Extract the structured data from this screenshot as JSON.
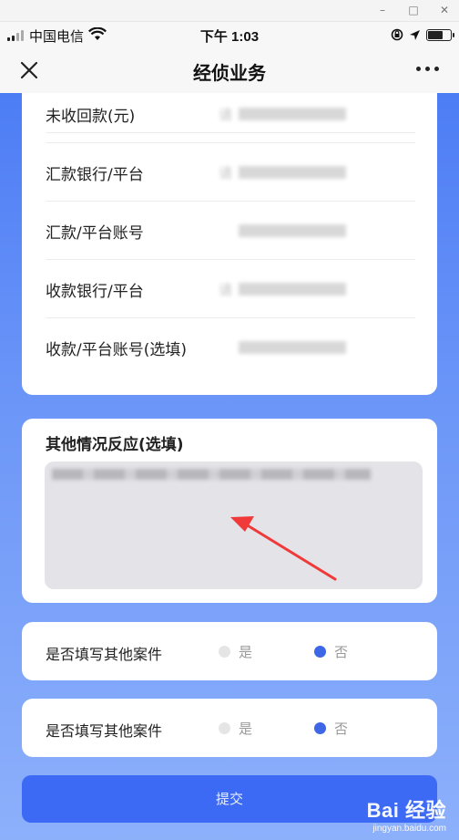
{
  "status_bar": {
    "carrier": "中国电信",
    "time": "下午 1:03"
  },
  "nav": {
    "title": "经侦业务",
    "close_icon": "close-icon",
    "more_icon": "more-icon"
  },
  "form": {
    "rows": [
      {
        "label": "未收回款(元)",
        "value": "请"
      },
      {
        "label": "汇款银行/平台",
        "value": "请"
      },
      {
        "label": "汇款/平台账号",
        "value": ""
      },
      {
        "label": "收款银行/平台",
        "value": "请"
      },
      {
        "label": "收款/平台账号(选填)",
        "value": ""
      }
    ]
  },
  "notes": {
    "title": "其他情况反应(选填)",
    "value": ""
  },
  "radios": [
    {
      "question": "是否填写其他案件",
      "yes": "是",
      "no": "否",
      "selected": "no"
    },
    {
      "question": "是否填写其他案件",
      "yes": "是",
      "no": "否",
      "selected": "no"
    }
  ],
  "submit_label": "提交",
  "watermark": {
    "logo": "Bai 经验",
    "url": "jingyan.baidu.com"
  },
  "colors": {
    "accent": "#3c6af5",
    "radio_on": "#3d67e6",
    "annotation_arrow": "#f03a3a"
  }
}
